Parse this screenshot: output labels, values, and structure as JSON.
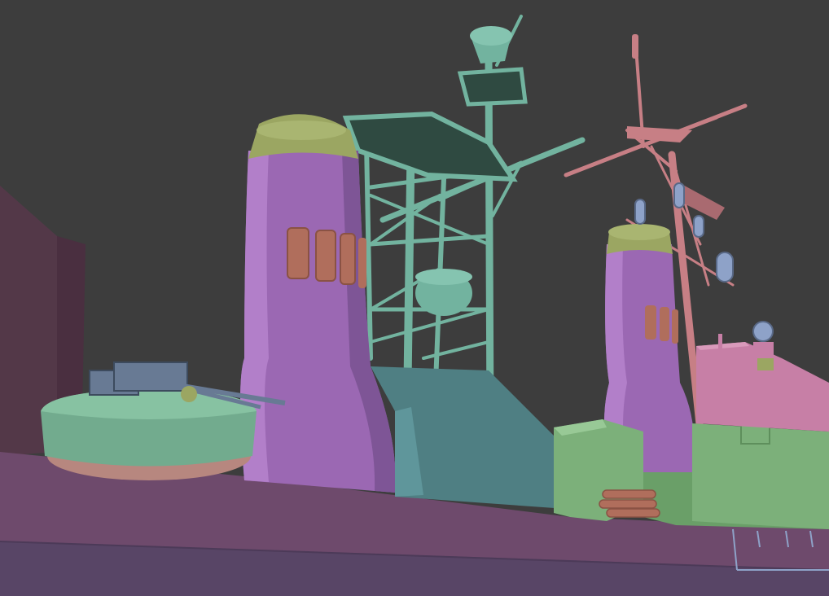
{
  "scene": {
    "subject": "warship-superstructure-render",
    "palette": {
      "background": "#3d3d3d",
      "hull_deck": "#6e4a6c",
      "hull_side": "#584566",
      "funnel": "#9b68b3",
      "funnel_shade": "#7e5596",
      "funnel_cap": "#9ba662",
      "vent": "#b06e5c",
      "mast_green": "#72b39f",
      "mast_dark": "#2f4a41",
      "mast_pink": "#c77f85",
      "deckhouse_teal": "#4f7f83",
      "deckhouse_green": "#7cb07a",
      "deckhouse_pink": "#c77fa6",
      "turret": "#72ab8e",
      "turret_base": "#b7877f",
      "gun_blue": "#687a94",
      "sensor_blue": "#8ea2c8"
    },
    "icons": [
      "twin-gun-turret",
      "forward-funnel",
      "aft-funnel",
      "lattice-mast",
      "tripod-mast",
      "radar-dish",
      "searchlight-domes",
      "life-raft-canisters"
    ]
  }
}
